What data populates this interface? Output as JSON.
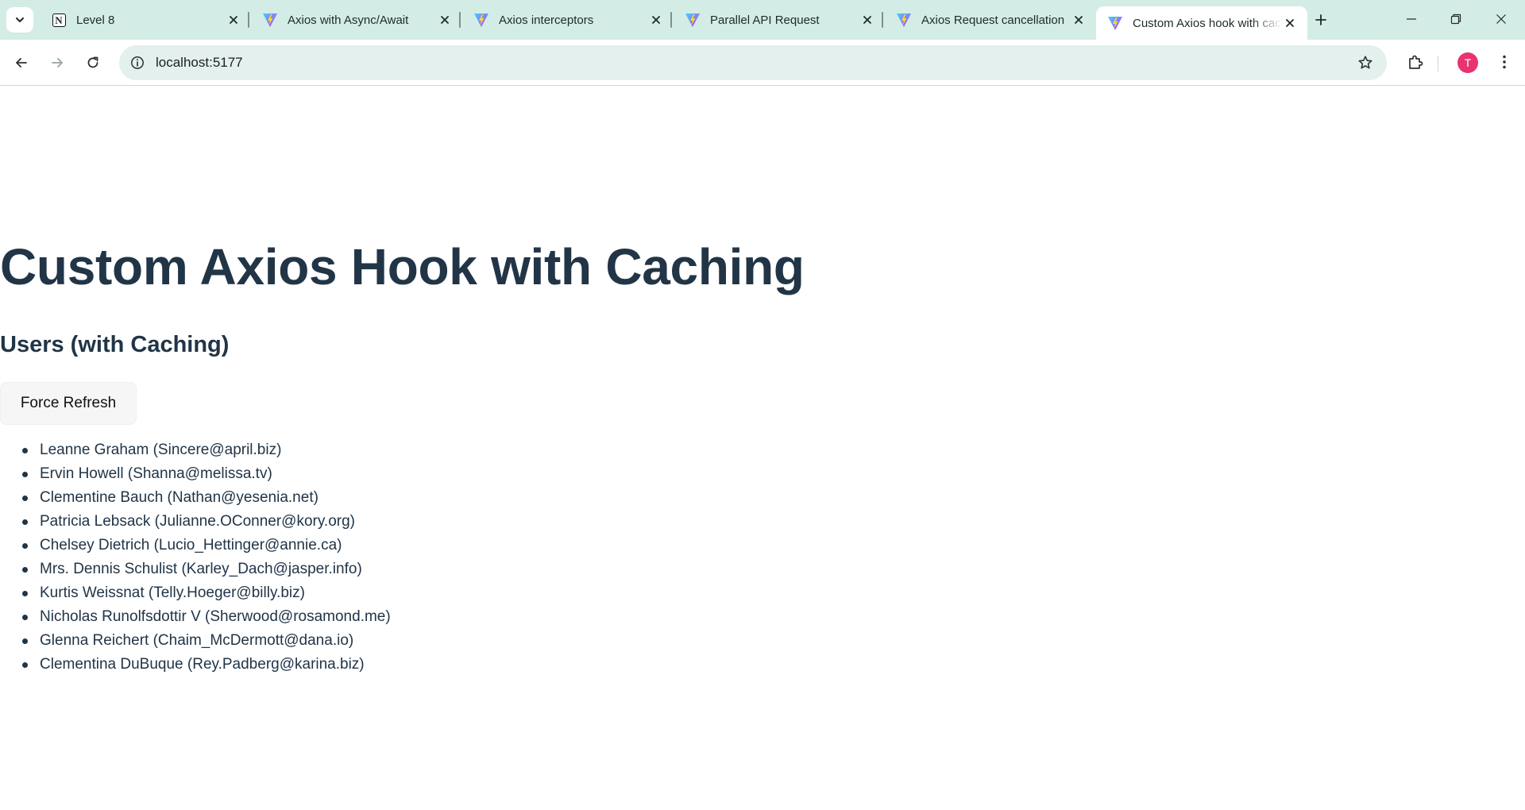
{
  "browser": {
    "tabs": [
      {
        "title": "Level 8",
        "favicon": "notion-icon",
        "active": false
      },
      {
        "title": "Axios with Async/Await",
        "favicon": "vite-icon",
        "active": false
      },
      {
        "title": "Axios interceptors",
        "favicon": "vite-icon",
        "active": false
      },
      {
        "title": "Parallel API Request",
        "favicon": "vite-icon",
        "active": false
      },
      {
        "title": "Axios Request cancellation",
        "favicon": "vite-icon",
        "active": false
      },
      {
        "title": "Custom Axios hook with caching",
        "favicon": "vite-icon",
        "active": true
      }
    ],
    "url": "localhost:5177",
    "profile_initial": "T",
    "colors": {
      "tabstrip": "#d3ece6",
      "omnibox": "#e3f0ed",
      "avatar": "#e8336f"
    }
  },
  "page": {
    "title": "Custom Axios Hook with Caching",
    "section_title": "Users (with Caching)",
    "refresh_button": "Force Refresh",
    "users": [
      "Leanne Graham (Sincere@april.biz)",
      "Ervin Howell (Shanna@melissa.tv)",
      "Clementine Bauch (Nathan@yesenia.net)",
      "Patricia Lebsack (Julianne.OConner@kory.org)",
      "Chelsey Dietrich (Lucio_Hettinger@annie.ca)",
      "Mrs. Dennis Schulist (Karley_Dach@jasper.info)",
      "Kurtis Weissnat (Telly.Hoeger@billy.biz)",
      "Nicholas Runolfsdottir V (Sherwood@rosamond.me)",
      "Glenna Reichert (Chaim_McDermott@dana.io)",
      "Clementina DuBuque (Rey.Padberg@karina.biz)"
    ],
    "colors": {
      "heading": "#213547",
      "button_bg": "#f6f6f6"
    }
  }
}
